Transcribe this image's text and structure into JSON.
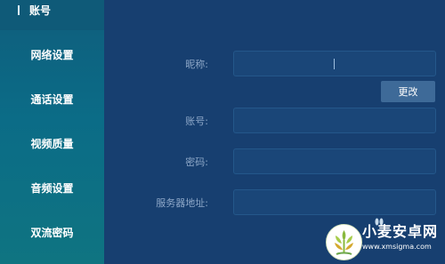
{
  "sidebar": {
    "header_label": "账号",
    "items": [
      {
        "label": "网络设置"
      },
      {
        "label": "通话设置"
      },
      {
        "label": "视频质量"
      },
      {
        "label": "音频设置"
      },
      {
        "label": "双流密码"
      }
    ]
  },
  "form": {
    "nickname": {
      "label": "昵称:",
      "value": ""
    },
    "change_button": "更改",
    "account": {
      "label": "账号:",
      "value": ""
    },
    "password": {
      "label": "密码:",
      "value": ""
    },
    "server": {
      "label": "服务器地址:",
      "value": ""
    }
  },
  "watermark": {
    "title": "小麦安卓网",
    "url": "www.xmsigma.com"
  },
  "colors": {
    "main_bg": "#173f70",
    "sidebar": "#0f6580",
    "field_bg": "#1a4678",
    "button_bg": "#3e6a98",
    "label": "#8ea8c8",
    "text": "#ffffff"
  }
}
